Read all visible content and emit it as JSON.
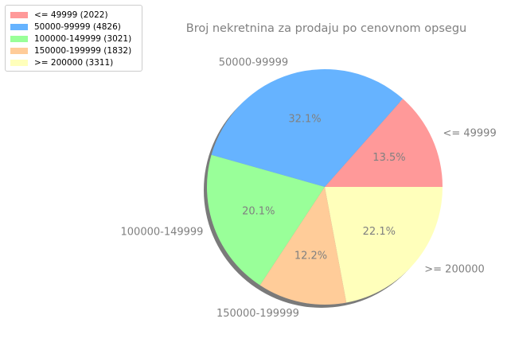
{
  "chart_data": {
    "type": "pie",
    "title": "Broj nekretnina za prodaju po cenovnom opsegu",
    "categories": [
      "<= 49999",
      "50000-99999",
      "100000-149999",
      "150000-199999",
      ">= 200000"
    ],
    "values": [
      2022,
      4826,
      3021,
      1832,
      3311
    ],
    "percent_labels": [
      "13.5%",
      "32.1%",
      "20.1%",
      "12.2%",
      "22.1%"
    ],
    "legend_entries": [
      "<= 49999 (2022)",
      "50000-99999 (4826)",
      "100000-149999 (3021)",
      "150000-199999 (1832)",
      ">= 200000 (3311)"
    ],
    "colors": [
      "#ff9999",
      "#66b3ff",
      "#99ff99",
      "#ffcc99",
      "#ffffbb"
    ],
    "start_angle": 0,
    "direction": "counterclockwise",
    "shadow": true,
    "legend_position": "top-left",
    "text_color": "#808080"
  }
}
